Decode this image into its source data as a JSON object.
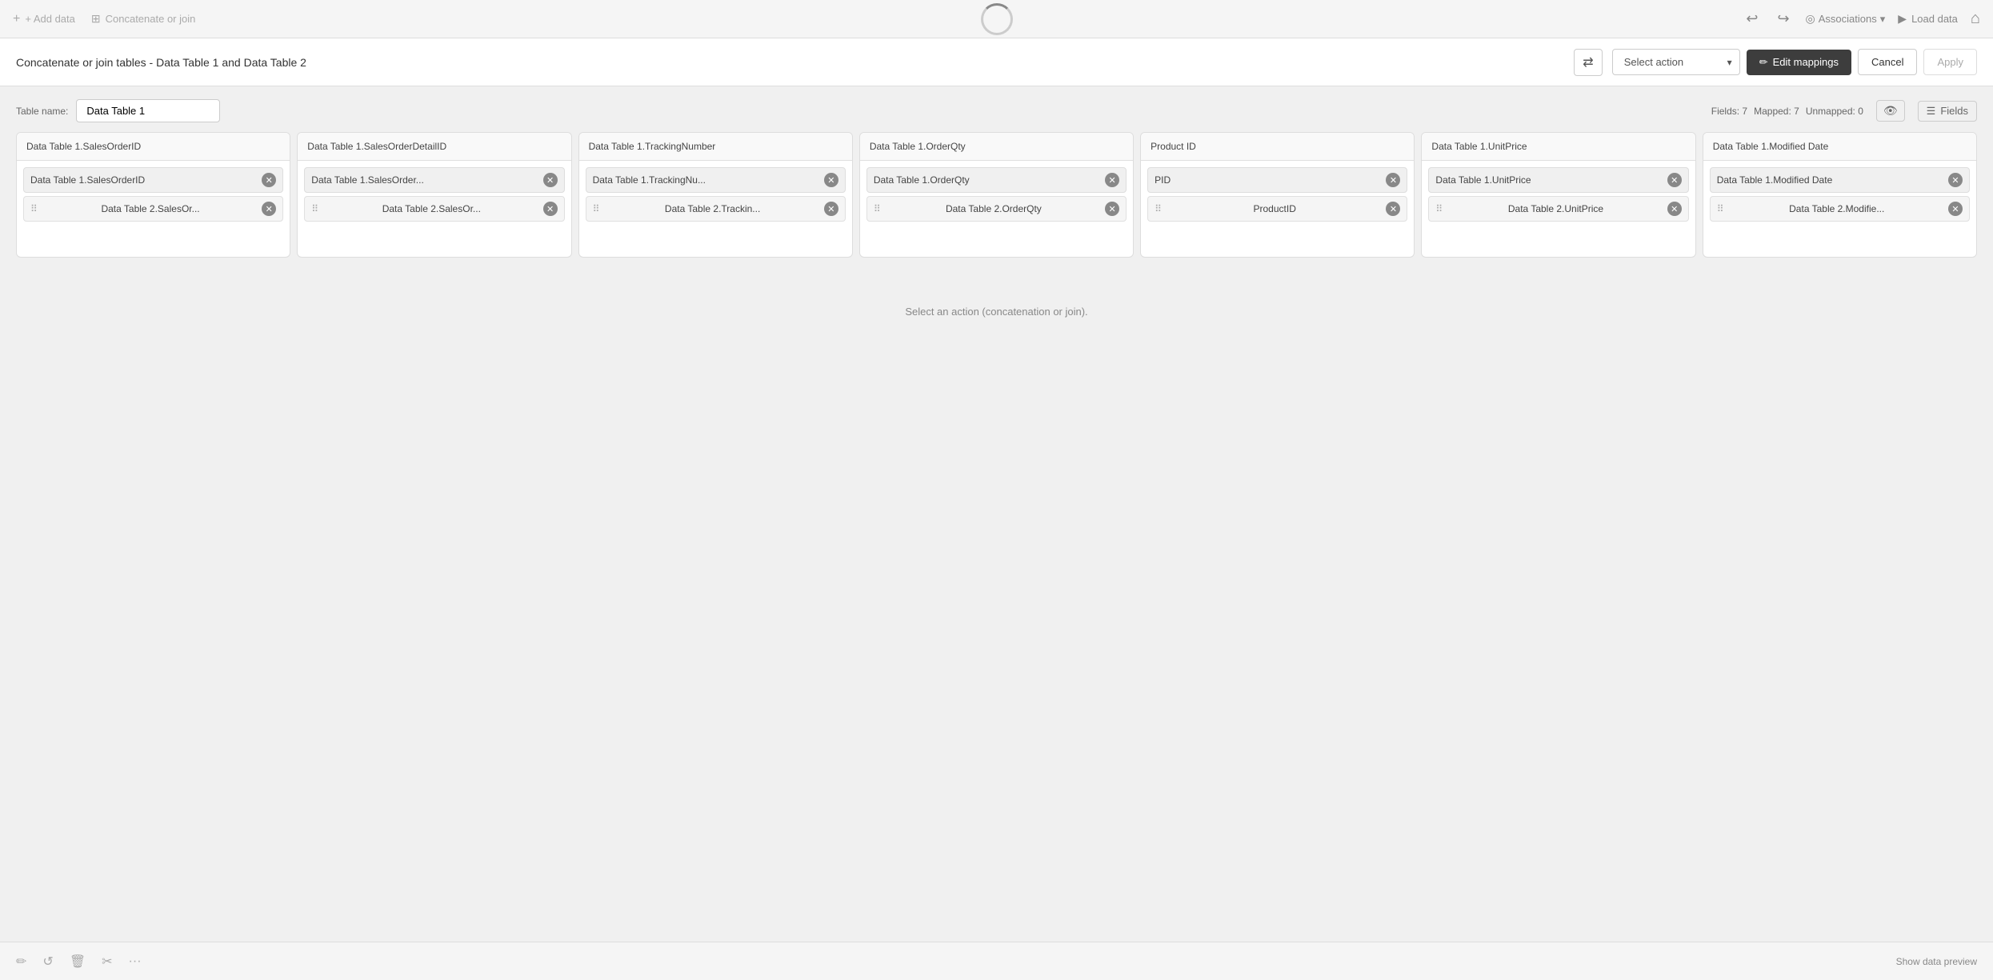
{
  "topnav": {
    "add_data_label": "+ Add data",
    "concat_join_label": "Concatenate or join",
    "undo_icon": "↩",
    "redo_icon": "↪",
    "associations_label": "Associations",
    "load_data_label": "Load data",
    "home_icon": "⌂"
  },
  "header": {
    "title": "Concatenate or join tables - Data Table 1 and Data Table 2",
    "swap_icon": "⇄",
    "select_action_placeholder": "Select action",
    "edit_mappings_label": "Edit mappings",
    "cancel_label": "Cancel",
    "apply_label": "Apply"
  },
  "table_name": {
    "label": "Table name:",
    "value": "Data Table 1"
  },
  "fields_info": {
    "fields_label": "Fields: 7",
    "mapped_label": "Mapped: 7",
    "unmapped_label": "Unmapped: 0",
    "fields_btn_label": "Fields"
  },
  "columns": [
    {
      "header": "Data Table 1.SalesOrderID",
      "row1_chip": "Data Table 1.SalesOrderID",
      "row2_chip": "Data Table 2.SalesOr..."
    },
    {
      "header": "Data Table 1.SalesOrderDetailID",
      "row1_chip": "Data Table 1.SalesOrder...",
      "row2_chip": "Data Table 2.SalesOr..."
    },
    {
      "header": "Data Table 1.TrackingNumber",
      "row1_chip": "Data Table 1.TrackingNu...",
      "row2_chip": "Data Table 2.Trackin..."
    },
    {
      "header": "Data Table 1.OrderQty",
      "row1_chip": "Data Table 1.OrderQty",
      "row2_chip": "Data Table 2.OrderQty"
    },
    {
      "header": "Product ID",
      "row1_chip": "PID",
      "row2_chip": "ProductID"
    },
    {
      "header": "Data Table 1.UnitPrice",
      "row1_chip": "Data Table 1.UnitPrice",
      "row2_chip": "Data Table 2.UnitPrice"
    },
    {
      "header": "Data Table 1.Modified Date",
      "row1_chip": "Data Table 1.Modified Date",
      "row2_chip": "Data Table 2.Modifie..."
    }
  ],
  "bottom_status": {
    "message": "Select an action (concatenation or join)."
  },
  "bottom_toolbar": {
    "icons": [
      "✏️",
      "↺",
      "🗑",
      "✂",
      "···"
    ],
    "show_data_label": "Show data preview"
  }
}
